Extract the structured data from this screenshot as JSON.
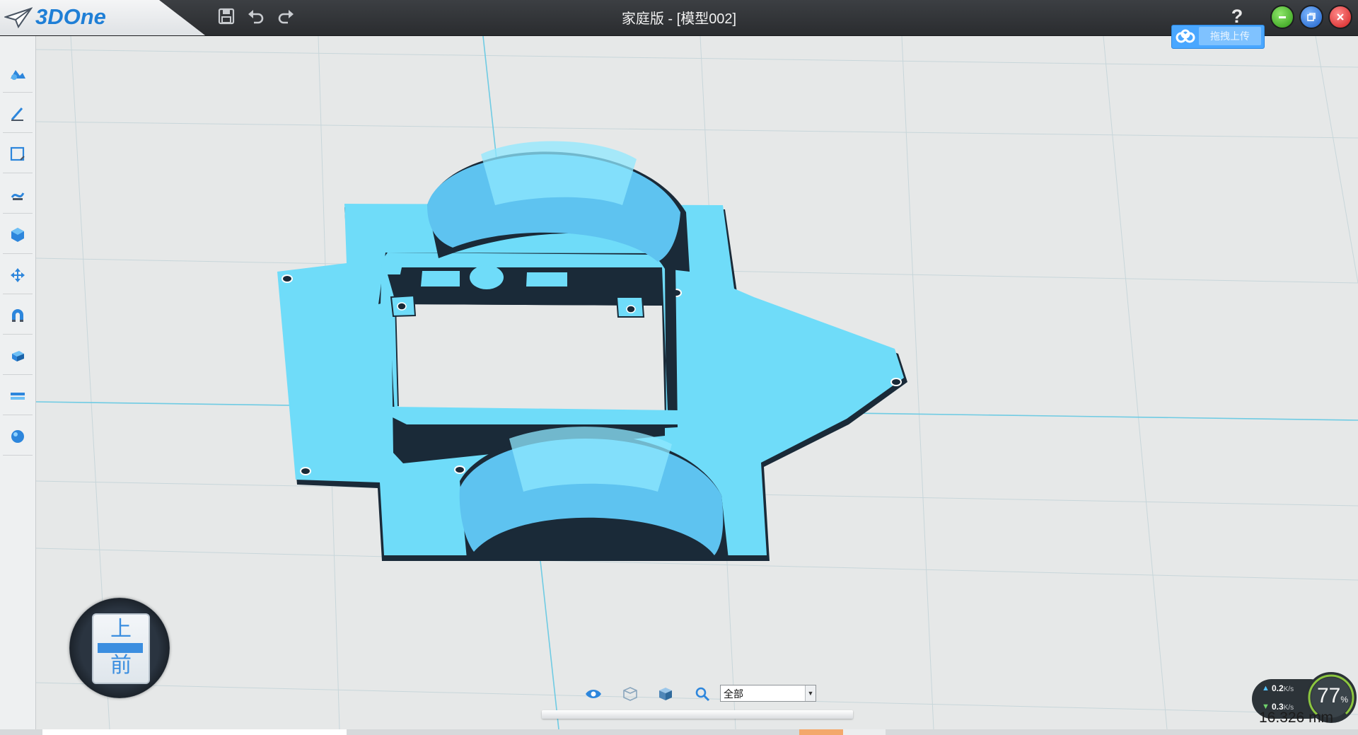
{
  "app": {
    "logo_text": "3DOne",
    "title": "家庭版 - [模型002]"
  },
  "titlebar": {
    "help_label": "?",
    "upload_label": "拖拽上传",
    "icons": [
      "save-icon",
      "undo-icon",
      "redo-icon",
      "help-icon",
      "minimize-icon",
      "restore-icon",
      "close-icon",
      "cloud-upload-icon"
    ]
  },
  "sidebar": {
    "items": [
      {
        "name": "basic-solid-icon"
      },
      {
        "name": "sketch-icon"
      },
      {
        "name": "sketch-edit-icon"
      },
      {
        "name": "special-feature-icon"
      },
      {
        "name": "feature-modeling-icon"
      },
      {
        "name": "move-icon"
      },
      {
        "name": "combine-icon"
      },
      {
        "name": "assembly-icon"
      },
      {
        "name": "measure-icon"
      },
      {
        "name": "material-icon"
      }
    ]
  },
  "viewcube": {
    "top_label": "上",
    "front_label": "前"
  },
  "bottom_bar": {
    "filter_value": "全部",
    "icons": [
      "show-hide-icon",
      "wireframe-icon",
      "shaded-icon",
      "zoom-icon"
    ]
  },
  "net_monitor": {
    "upload_speed": "0.2",
    "download_speed": "0.3",
    "unit": "K/s",
    "gauge_value": "77",
    "gauge_unit": "%"
  },
  "measurement": {
    "text": "16.326 mm"
  },
  "colors": {
    "model_face": "#6fdcf9",
    "model_shadow": "#1a2a38",
    "grid_major": "#6fcbe3",
    "grid_minor": "#c8d6da",
    "accent": "#1f7fd6"
  }
}
